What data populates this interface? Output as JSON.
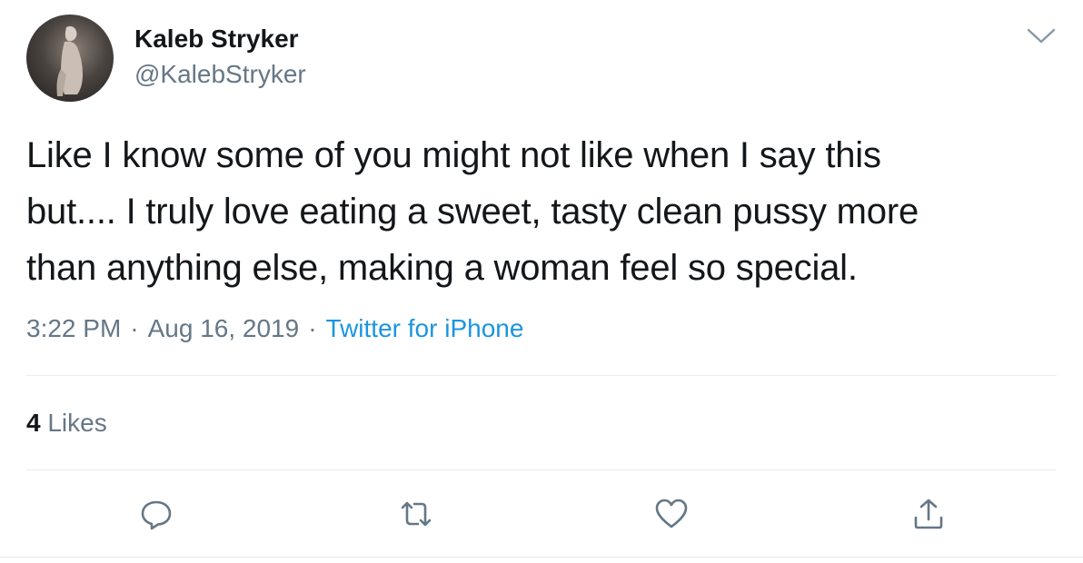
{
  "author": {
    "display_name": "Kaleb Stryker",
    "handle": "@KalebStryker"
  },
  "tweet": {
    "text_lines": [
      "Like I know some of you might not like when I say this",
      "but.... I truly love eating a sweet, tasty clean pussy more",
      "than anything else, making a woman feel so special."
    ],
    "time": "3:22 PM",
    "date": "Aug 16, 2019",
    "source": "Twitter for iPhone",
    "separator": "·"
  },
  "stats": {
    "likes_count": "4",
    "likes_label": "Likes"
  },
  "icons": {
    "more": "chevron-down-icon",
    "reply": "reply-icon",
    "retweet": "retweet-icon",
    "like": "heart-icon",
    "share": "share-icon"
  },
  "colors": {
    "text": "#14171a",
    "secondary": "#657786",
    "link": "#1b95e0",
    "divider": "#e6ecf0"
  }
}
